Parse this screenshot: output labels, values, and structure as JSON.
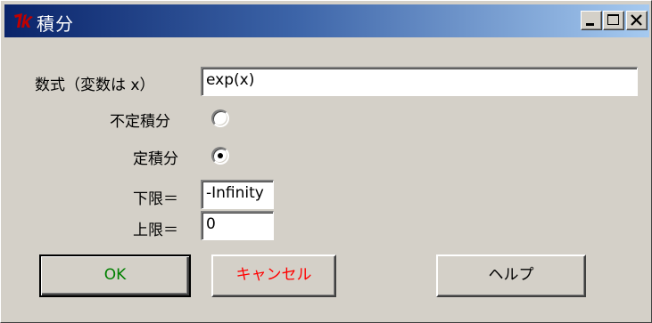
{
  "window": {
    "title": "積分",
    "title_bar_buttons": [
      "minimize-icon",
      "maximize-icon",
      "close-icon"
    ]
  },
  "form": {
    "expression_label": "数式（変数は x）",
    "expression_value": "exp(x)",
    "indefinite_label": "不定積分",
    "indefinite_selected": false,
    "definite_label": "定積分",
    "definite_selected": true,
    "lower_label": "下限＝",
    "lower_value": "-Infinity",
    "upper_label": "上限＝",
    "upper_value": "0"
  },
  "buttons": {
    "ok_label": "OK",
    "cancel_label": "キャンセル",
    "help_label": "ヘルプ"
  },
  "colors": {
    "ok_text": "#008000",
    "cancel_text": "#ff0000",
    "help_text": "#000000",
    "titlebar_start": "#0a246a",
    "titlebar_end": "#a6caf0"
  }
}
